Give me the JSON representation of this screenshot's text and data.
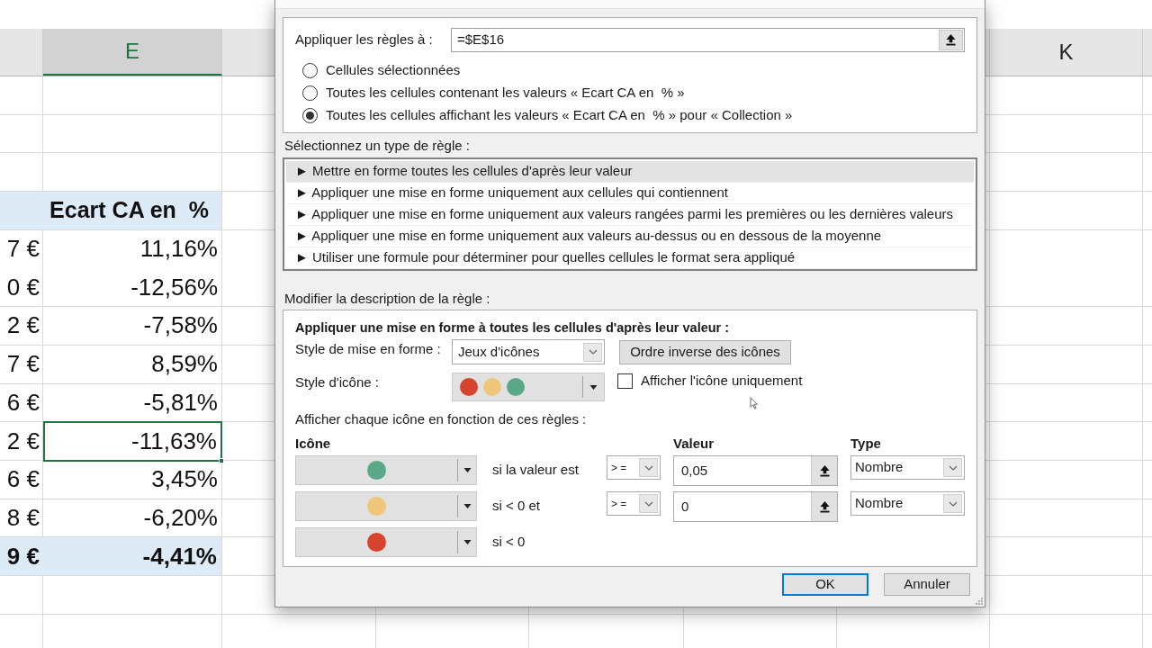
{
  "spreadsheet": {
    "column_headers": [
      {
        "label": "E",
        "selected": true
      },
      {
        "label": "K",
        "selected": false
      }
    ],
    "table_header": {
      "label": "Ecart CA en  %"
    },
    "rows": [
      {
        "column_1": "7 €",
        "ecart_ca_en_pct": "11,16%",
        "selected": false
      },
      {
        "column_1": "0 €",
        "ecart_ca_en_pct": "-12,56%",
        "selected": false
      },
      {
        "column_1": "2 €",
        "ecart_ca_en_pct": "-7,58%",
        "selected": false
      },
      {
        "column_1": "7 €",
        "ecart_ca_en_pct": "8,59%",
        "selected": false
      },
      {
        "column_1": "6 €",
        "ecart_ca_en_pct": "-5,81%",
        "selected": false
      },
      {
        "column_1": "2 €",
        "ecart_ca_en_pct": "-11,63%",
        "selected": true
      },
      {
        "column_1": "6 €",
        "ecart_ca_en_pct": "3,45%",
        "selected": false
      },
      {
        "column_1": "8 €",
        "ecart_ca_en_pct": "-6,20%",
        "selected": false
      }
    ],
    "total_row": {
      "column_1": "9 €",
      "ecart_ca_en_pct": "-4,41%"
    }
  },
  "dialog": {
    "apply_to": {
      "label": "Appliquer les règles à :",
      "value": "=$E$16"
    },
    "scope_options": [
      {
        "label": "Cellules sélectionnées",
        "selected": false
      },
      {
        "label": "Toutes les cellules contenant les valeurs « Ecart CA en  % »",
        "selected": false
      },
      {
        "label": "Toutes les cellules affichant les valeurs « Ecart CA en  % » pour « Collection »",
        "selected": true
      }
    ],
    "rule_type_label": "Sélectionnez un type de règle :",
    "rule_types": [
      {
        "label": "► Mettre en forme toutes les cellules d'après leur valeur",
        "selected": true
      },
      {
        "label": "► Appliquer une mise en forme uniquement aux cellules qui contiennent",
        "selected": false
      },
      {
        "label": "► Appliquer une mise en forme uniquement aux valeurs rangées parmi les premières ou les dernières valeurs",
        "selected": false
      },
      {
        "label": "► Appliquer une mise en forme uniquement aux valeurs au-dessus ou en dessous de la moyenne",
        "selected": false
      },
      {
        "label": "► Utiliser une formule pour déterminer pour quelles cellules le format sera appliqué",
        "selected": false
      }
    ],
    "description_label": "Modifier la description de la règle :",
    "description": {
      "title": "Appliquer une mise en forme à toutes les cellules d'après leur valeur :",
      "format_style": {
        "label": "Style de mise en forme :",
        "value": "Jeux d'icônes"
      },
      "reverse_button": "Ordre inverse des icônes",
      "icon_style": {
        "label": "Style d'icône :",
        "icons": [
          {
            "color": "#d6432f"
          },
          {
            "color": "#eec77a"
          },
          {
            "color": "#5aa887"
          }
        ]
      },
      "icon_only": {
        "label": "Afficher l'icône uniquement",
        "checked": false
      },
      "rules_label": "Afficher chaque icône en fonction de ces règles :",
      "headers": {
        "icon": "Icône",
        "value": "Valeur",
        "type": "Type"
      },
      "rules": [
        {
          "color": "#5aa887",
          "condition": "si la valeur est",
          "operator": "> =",
          "value": "0,05",
          "type": "Nombre"
        },
        {
          "color": "#eec77a",
          "condition": "si < 0 et",
          "operator": "> =",
          "value": "0",
          "type": "Nombre"
        },
        {
          "color": "#d6432f",
          "condition": "si < 0"
        }
      ]
    },
    "buttons": [
      {
        "label": "OK",
        "focused": true
      },
      {
        "label": "Annuler",
        "focused": false
      }
    ]
  }
}
